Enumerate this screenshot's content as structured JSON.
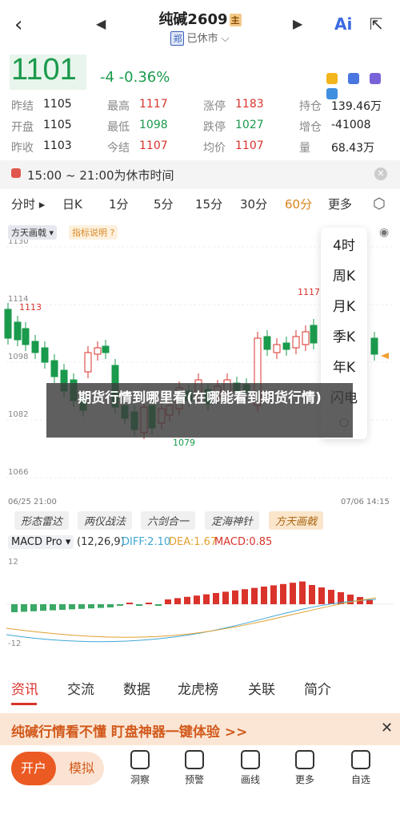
{
  "header": {
    "title": "纯碱2609",
    "title_tag": "主",
    "exchange_tag": "郑",
    "status": "已休市",
    "ai_label": "Ai"
  },
  "quote": {
    "price": "1101",
    "change": "-4 -0.36%"
  },
  "stats": {
    "rows": [
      [
        {
          "label": "昨结",
          "value": "1105",
          "color": "dark"
        },
        {
          "label": "最高",
          "value": "1117",
          "color": "red"
        },
        {
          "label": "涨停",
          "value": "1183",
          "color": "red"
        },
        {
          "label": "持仓",
          "value": "139.46万",
          "color": "dark"
        }
      ],
      [
        {
          "label": "开盘",
          "value": "1105",
          "color": "dark"
        },
        {
          "label": "最低",
          "value": "1098",
          "color": "green"
        },
        {
          "label": "跌停",
          "value": "1027",
          "color": "green"
        },
        {
          "label": "增仓",
          "value": "-41008",
          "color": "dark"
        }
      ],
      [
        {
          "label": "昨收",
          "value": "1103",
          "color": "dark"
        },
        {
          "label": "今结",
          "value": "1107",
          "color": "red"
        },
        {
          "label": "均价",
          "value": "1107",
          "color": "red"
        },
        {
          "label": "量",
          "value": "68.43万",
          "color": "dark"
        }
      ]
    ]
  },
  "session": {
    "text": "15:00 ~ 21:00为休市时间"
  },
  "tabs": {
    "items": [
      "分时",
      "日K",
      "1分",
      "5分",
      "15分",
      "30分",
      "60分",
      "更多"
    ],
    "active": "60分"
  },
  "chart": {
    "indicator_badge": "方天画戟",
    "help_badge": "指标说明",
    "y_labels": [
      "1130",
      "1114",
      "1098",
      "1082",
      "1066"
    ],
    "high_label": "1117",
    "low_label": "1079",
    "mark_label": "1113",
    "date_left": "06/25 21:00",
    "date_right": "07/06 14:15"
  },
  "more_menu": [
    "4时",
    "周K",
    "月K",
    "季K",
    "年K",
    "闪电"
  ],
  "banner": {
    "text": "期货行情到哪里看(在哪能看到期货行情)"
  },
  "strategies": {
    "items": [
      "形态雷达",
      "两仪战法",
      "六剑合一",
      "定海神针",
      "方天画戟"
    ],
    "active": "方天画戟"
  },
  "macd": {
    "name": "MACD Pro",
    "params": "(12,26,9)",
    "dif": "DIFF:2.10",
    "dea": "DEA:1.67",
    "macd": "MACD:0.85",
    "y_top": "12",
    "y_bottom": "-12"
  },
  "bottom_tabs": {
    "items": [
      "资讯",
      "交流",
      "数据",
      "龙虎榜",
      "关联",
      "简介"
    ],
    "active": "资讯"
  },
  "promo": {
    "text": "纯碱行情看不懂  盯盘神器一键体验 >>"
  },
  "dock": {
    "open": "开户",
    "demo": "模拟",
    "items": [
      "洞察",
      "预警",
      "画线",
      "更多",
      "自选"
    ]
  },
  "colors": {
    "up": "#d9332b",
    "down": "#1a9a4c",
    "accent": "#d9841c"
  }
}
